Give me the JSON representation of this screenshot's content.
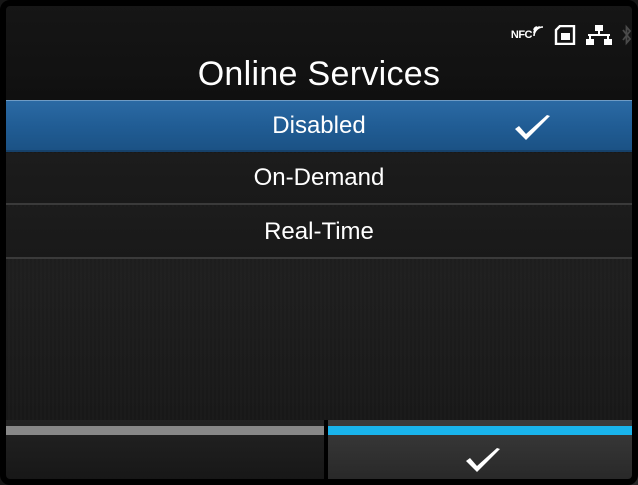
{
  "status_bar": {
    "nfc_label": "NFC",
    "icons": [
      "nfc-icon",
      "sd-card-icon",
      "network-icon",
      "bluetooth-icon"
    ]
  },
  "header": {
    "title": "Online Services"
  },
  "options": [
    {
      "label": "Disabled",
      "selected": true
    },
    {
      "label": "On-Demand",
      "selected": false
    },
    {
      "label": "Real-Time",
      "selected": false
    }
  ],
  "footer": {
    "left_key": "",
    "right_key_icon": "check-icon"
  },
  "colors": {
    "selection": "#215d95",
    "right_indicator": "#19b4ec",
    "left_indicator": "#888888"
  }
}
